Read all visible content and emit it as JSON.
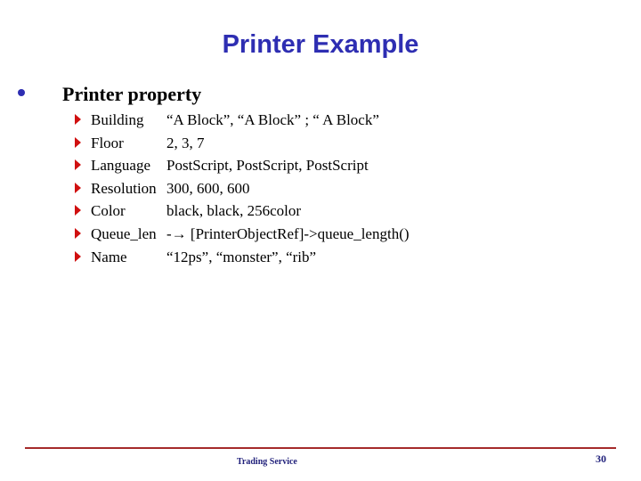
{
  "slide": {
    "title": "Printer Example",
    "bullet": "Printer property",
    "properties": [
      {
        "key": "Building",
        "value": "“A Block”, “A Block” ; “ A Block”"
      },
      {
        "key": "Floor",
        "value": "2, 3, 7"
      },
      {
        "key": "Language",
        "value": "PostScript, PostScript, PostScript"
      },
      {
        "key": "Resolution",
        "value": "300, 600, 600"
      },
      {
        "key": "Color",
        "value": "black, black, 256color"
      },
      {
        "key": "Queue_len",
        "value": "-→ [PrinterObjectRef]->queue_length()"
      },
      {
        "key": "Name",
        "value": "“12ps”, “monster”, “rib”"
      }
    ],
    "footer": "Trading Service",
    "page_number": "30"
  },
  "icons": {
    "bullet_level1": "round-dot-icon",
    "bullet_level2": "triangle-right-icon"
  },
  "colors": {
    "title": "#2e2eb2",
    "sub_bullet": "#d01010",
    "rule": "#a52a2a"
  }
}
